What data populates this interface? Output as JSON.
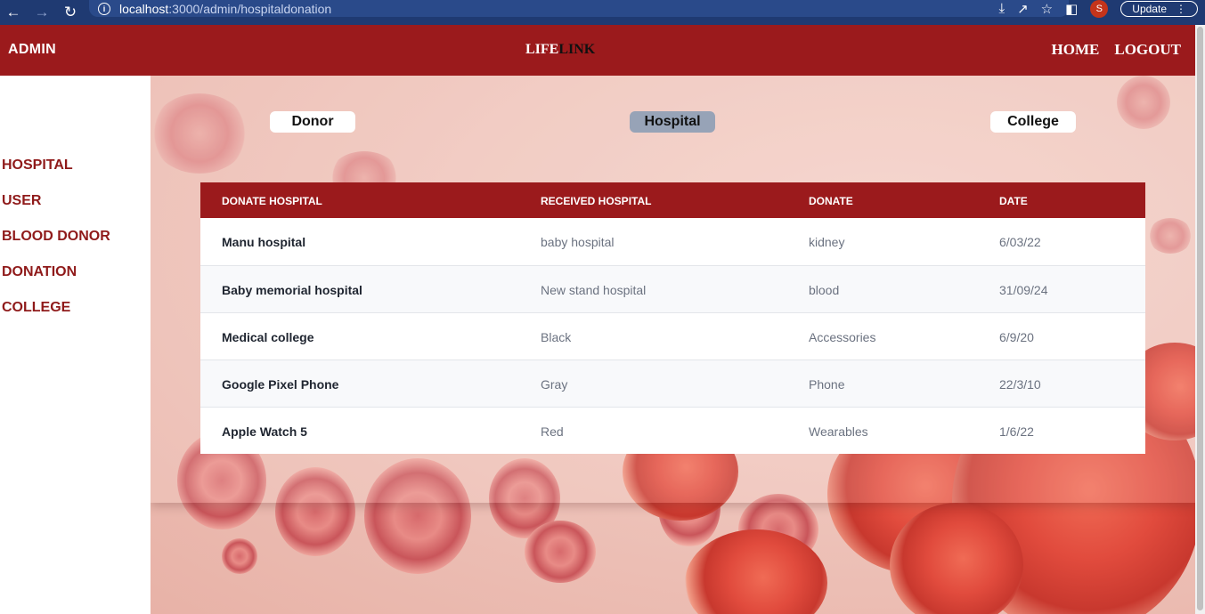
{
  "browser": {
    "url_host": "localhost",
    "url_path": ":3000/admin/hospitaldonation",
    "profile_initial": "S",
    "update_label": "Update"
  },
  "header": {
    "admin_label": "ADMIN",
    "brand_part1": "LIFE",
    "brand_part2": "LINK",
    "nav": {
      "home": "HOME",
      "logout": "LOGOUT"
    }
  },
  "sidebar": {
    "items": [
      {
        "label": "HOSPITAL"
      },
      {
        "label": "USER"
      },
      {
        "label": "BLOOD DONOR"
      },
      {
        "label": "DONATION"
      },
      {
        "label": "COLLEGE"
      }
    ]
  },
  "tabs": [
    {
      "label": "Donor",
      "active": false
    },
    {
      "label": "Hospital",
      "active": true
    },
    {
      "label": "College",
      "active": false
    }
  ],
  "table": {
    "headers": [
      "DONATE HOSPITAL",
      "RECEIVED HOSPITAL",
      "DONATE",
      "DATE"
    ],
    "rows": [
      [
        "Manu hospital",
        "baby hospital",
        "kidney",
        "6/03/22"
      ],
      [
        "Baby memorial hospital",
        "New stand hospital",
        "blood",
        "31/09/24"
      ],
      [
        "Medical college",
        "Black",
        "Accessories",
        "6/9/20"
      ],
      [
        "Google Pixel Phone",
        "Gray",
        "Phone",
        "22/3/10"
      ],
      [
        "Apple Watch 5",
        "Red",
        "Wearables",
        "1/6/22"
      ]
    ]
  },
  "colors": {
    "brand_red": "#9b1a1c",
    "sidebar_text": "#8f1a1a",
    "active_tab": "#97a3b7",
    "chrome_bar": "#1f3a72"
  }
}
